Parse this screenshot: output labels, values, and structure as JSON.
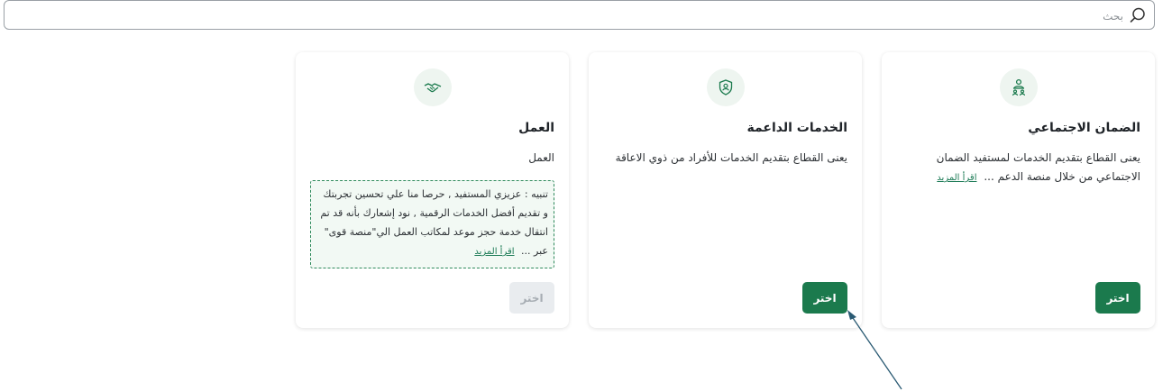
{
  "search": {
    "placeholder": "بحث"
  },
  "cards": [
    {
      "title": "الضمان الاجتماعي",
      "description": "يعنى القطاع بتقديم الخدمات لمستفيد الضمان الاجتماعي من خلال منصة الدعم ...",
      "read_more": "اقرأ المزيد",
      "button": "اختر",
      "icon": "people-group-icon"
    },
    {
      "title": "الخدمات الداعمة",
      "description": "يعنى القطاع بتقديم الخدمات للأفراد من ذوي الاعاقة",
      "button": "اختر",
      "icon": "shield-person-icon"
    },
    {
      "title": "العمل",
      "description": "العمل",
      "note": "تنبيه : عزيزي المستفيد , حرصا منا علي تحسين تجربتك و تقديم أفضل الخدمات الرقمية , نود إشعارك بأنه قد تم انتقال خدمة حجز موعد لمكاتب العمل الي\"منصة قوى\" عبر ...",
      "read_more": "اقرأ المزيد",
      "button": "اختر",
      "button_state": "disabled",
      "icon": "handshake-icon"
    }
  ],
  "colors": {
    "accent": "#1b7a4d",
    "icon_bg": "#eef5f0",
    "note_border": "#2f8a5c",
    "link": "#1b7a55"
  }
}
